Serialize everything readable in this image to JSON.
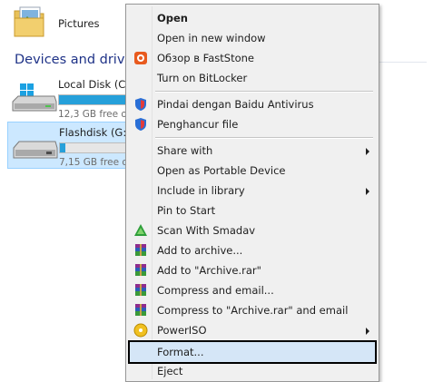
{
  "explorer": {
    "folder": {
      "label": "Pictures",
      "icon": "pictures-folder-icon"
    },
    "group_header": "Devices and drives",
    "drives": [
      {
        "label": "Local Disk (C:",
        "free": "12,3 GB free o",
        "used_fraction": 0.78,
        "icon": "windows-drive-icon",
        "selected": false
      },
      {
        "label": "Flashdisk (G:)",
        "free": "7,15 GB free o",
        "used_fraction": 0.05,
        "icon": "usb-drive-icon",
        "selected": true
      }
    ]
  },
  "context_menu": {
    "items": [
      {
        "label": "Open",
        "bold": true,
        "icon": "",
        "submenu": false
      },
      {
        "label": "Open in new window",
        "icon": "",
        "submenu": false
      },
      {
        "label": "Обзор в FastStone",
        "icon": "faststone-icon",
        "submenu": false
      },
      {
        "label": "Turn on BitLocker",
        "icon": "",
        "submenu": false
      },
      {
        "label": "Pindai dengan Baidu Antivirus",
        "icon": "baidu-antivirus-icon",
        "submenu": false
      },
      {
        "label": "Penghancur file",
        "icon": "baidu-antivirus-icon",
        "submenu": false
      },
      {
        "label": "Share with",
        "icon": "",
        "submenu": true
      },
      {
        "label": "Open as Portable Device",
        "icon": "",
        "submenu": false
      },
      {
        "label": "Include in library",
        "icon": "",
        "submenu": true
      },
      {
        "label": "Pin to Start",
        "icon": "",
        "submenu": false
      },
      {
        "label": "Scan With Smadav",
        "icon": "smadav-icon",
        "submenu": false
      },
      {
        "label": "Add to archive...",
        "icon": "winrar-icon",
        "submenu": false
      },
      {
        "label": "Add to \"Archive.rar\"",
        "icon": "winrar-icon",
        "submenu": false
      },
      {
        "label": "Compress and email...",
        "icon": "winrar-icon",
        "submenu": false
      },
      {
        "label": "Compress to \"Archive.rar\" and email",
        "icon": "winrar-icon",
        "submenu": false
      },
      {
        "label": "PowerISO",
        "icon": "poweriso-icon",
        "submenu": true
      },
      {
        "label": "Format...",
        "icon": "",
        "submenu": false,
        "highlighted": true
      },
      {
        "label": "Eject",
        "icon": "",
        "submenu": false
      }
    ]
  },
  "colors": {
    "menu_bg": "#f0f0f0",
    "highlight_bg": "#d5e6f7",
    "drive_bar_fill": "#26a0da",
    "group_header": "#1e3287"
  }
}
